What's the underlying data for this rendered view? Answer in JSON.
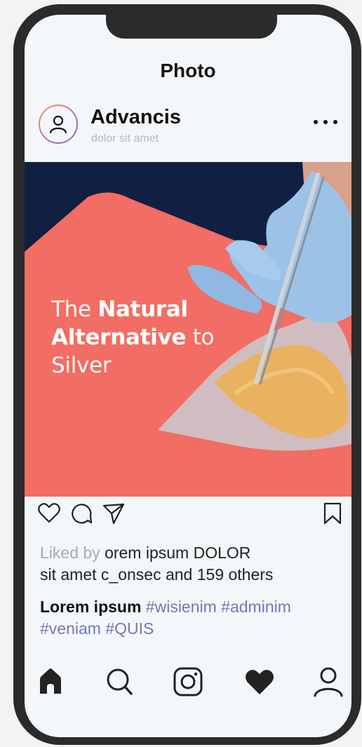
{
  "header": {
    "title": "Photo"
  },
  "post": {
    "username": "Advancis",
    "subtitle": "dolor sit amet",
    "headline": {
      "word1": "The ",
      "word2": "Natural",
      "word3": "Alternative",
      "word4": " to",
      "word5": "Silver"
    }
  },
  "likes": {
    "prefix": "Liked by ",
    "line1": "orem ipsum DOLOR",
    "line2": "sit amet c_onsec and 159 others"
  },
  "caption": {
    "author": "Lorem ipsum",
    "tags_line1": " #wisienim #adminim",
    "tags_line2": "#veniam #QUIS"
  },
  "icons": {
    "actions": [
      "heart-icon",
      "comment-icon",
      "share-icon",
      "bookmark-icon"
    ],
    "tabs": [
      "home-icon",
      "search-icon",
      "instagram-icon",
      "heart-icon",
      "profile-icon"
    ]
  },
  "colors": {
    "frame": "#2b2b2b",
    "screen": "#f4f7fa",
    "navy": "#111f43",
    "coral": "#f26d63",
    "hashtag": "#6f79b8",
    "muted": "#aaaaaa"
  }
}
